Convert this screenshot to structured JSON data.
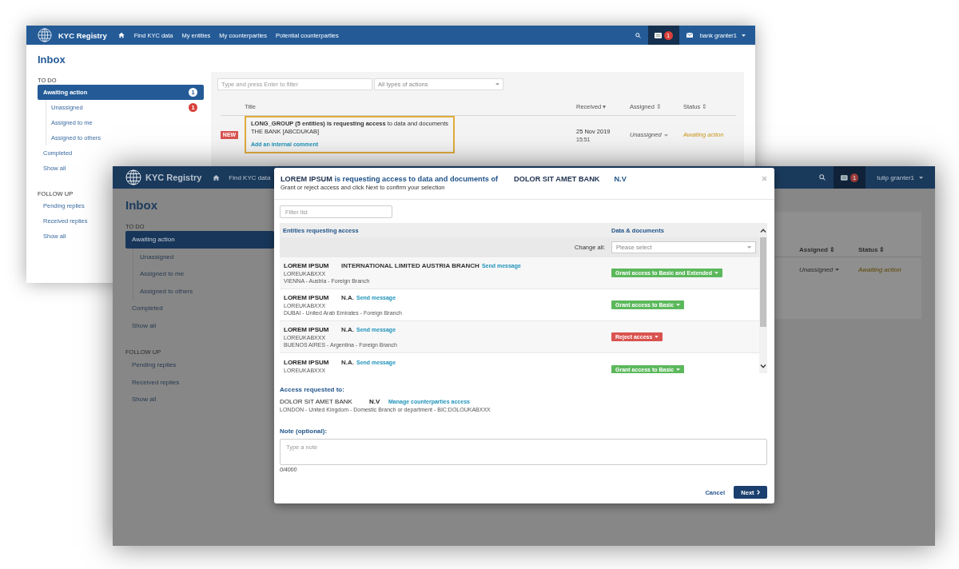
{
  "back_window": {
    "navbar": {
      "brand": "KYC Registry",
      "links": [
        "Find KYC data",
        "My entities",
        "My counterparties",
        "Potential counterparties"
      ],
      "notification_count": "1",
      "user": "bank granter1"
    },
    "page_title": "Inbox",
    "sidebar": [
      {
        "heading": "TO DO",
        "items": [
          {
            "label": "Awaiting action",
            "selected": true,
            "badge": "1",
            "children": [
              {
                "label": "Unassigned",
                "selected": false,
                "badge": "1"
              },
              {
                "label": "Assigned to me",
                "selected": false
              },
              {
                "label": "Assigned to others",
                "selected": false
              }
            ]
          },
          {
            "label": "Completed",
            "selected": false
          },
          {
            "label": "Show all",
            "selected": false
          }
        ]
      },
      {
        "heading": "FOLLOW UP",
        "items": [
          {
            "label": "Pending replies",
            "selected": false
          },
          {
            "label": "Received replies",
            "selected": false
          },
          {
            "label": "Show all",
            "selected": false
          }
        ]
      }
    ],
    "filter": {
      "placeholder": "Type and press Enter to filter"
    },
    "action_type": {
      "value": "All types of actions"
    },
    "columns": [
      {
        "label": "Title"
      },
      {
        "label": "Received",
        "icon": "▾"
      },
      {
        "label": "Assigned",
        "icon": "⇕"
      },
      {
        "label": "Status",
        "icon": "⇕"
      }
    ],
    "rows": [
      {
        "tag": "NEW",
        "title": "**LONG_GROUP (5 entities) is requesting access** to data and documents",
        "entity": "THE BANK [ABCDUKAB]",
        "link": "Add an internal comment",
        "received_date": "25 Nov 2019",
        "received_time": "15:51",
        "assigned": "Unassigned",
        "status": "Awaiting action",
        "highlighted": true
      }
    ]
  },
  "front_window": {
    "navbar": {
      "brand": "KYC Registry",
      "links": [
        "Find KYC data"
      ],
      "notification_count": "1",
      "user": "tulip granter1"
    },
    "page_title": "Inbox",
    "sidebar": [
      {
        "heading": "TO DO",
        "items": [
          {
            "label": "Awaiting action",
            "selected": true,
            "children": [
              {
                "label": "Unassigned",
                "selected": false
              },
              {
                "label": "Assigned to me",
                "selected": false
              },
              {
                "label": "Assigned to others",
                "selected": false
              }
            ]
          },
          {
            "label": "Completed",
            "selected": false
          },
          {
            "label": "Show all",
            "selected": false
          }
        ]
      },
      {
        "heading": "FOLLOW UP",
        "items": [
          {
            "label": "Pending replies",
            "selected": false
          },
          {
            "label": "Received replies",
            "selected": false
          },
          {
            "label": "Show all",
            "selected": false
          }
        ]
      }
    ],
    "columns": [
      {
        "label": "Assigned",
        "icon": "⇕"
      },
      {
        "label": "Status",
        "icon": "⇕"
      }
    ],
    "rows": [
      {
        "assigned": "Unassigned",
        "status": "Awaiting action"
      }
    ]
  },
  "dialog": {
    "title_requester": "LOREM IPSUM",
    "title_text": "is requesting access to data and documents of",
    "title_entity": "DOLOR SIT AMET BANK",
    "title_suffix": "N.V",
    "subtitle": "Grant or reject access and click Next to confirm your selection",
    "filter": {
      "placeholder": "Filter list"
    },
    "columns": [
      "Entities requesting access",
      "Data & documents"
    ],
    "change_all": {
      "label": "Change all:",
      "placeholder": "Please select"
    },
    "entities": [
      {
        "name": "LOREM IPSUM",
        "branch": "INTERNATIONAL LIMITED AUSTRIA BRANCH",
        "link": "Send message",
        "code": "LOREUKABXXX",
        "location": "VIENNA - Austria - Foreign Branch",
        "decision": "Grant access to Basic and Extended",
        "kind": "grant"
      },
      {
        "name": "LOREM IPSUM",
        "branch": "N.A.",
        "link": "Send message",
        "code": "LOREUKABXXX",
        "location": "DUBAI - United Arab Emirates - Foreign Branch",
        "decision": "Grant access to Basic",
        "kind": "grant"
      },
      {
        "name": "LOREM IPSUM",
        "branch": "N.A.",
        "link": "Send message",
        "code": "LOREUKABXXX",
        "location": "BUENOS AIRES - Argentina - Foreign Branch",
        "decision": "Reject access",
        "kind": "reject"
      },
      {
        "name": "LOREM IPSUM",
        "branch": "N.A.",
        "link": "Send message",
        "code": "LOREUKABXXX",
        "decision": "Grant access to Basic",
        "kind": "grant"
      }
    ],
    "access_heading": "Access requested to:",
    "target": {
      "name": "DOLOR SIT AMET BANK",
      "suffix": "N.V",
      "link": "Manage counterparties access",
      "details": "LONDON - United Kingdom - Domestic Branch or department - BIC:DOLOUKABXXX"
    },
    "note": {
      "label": "Note (optional):",
      "placeholder": "Type a note",
      "counter": "0/4000"
    },
    "buttons": {
      "cancel": "Cancel",
      "next": "Next"
    }
  }
}
